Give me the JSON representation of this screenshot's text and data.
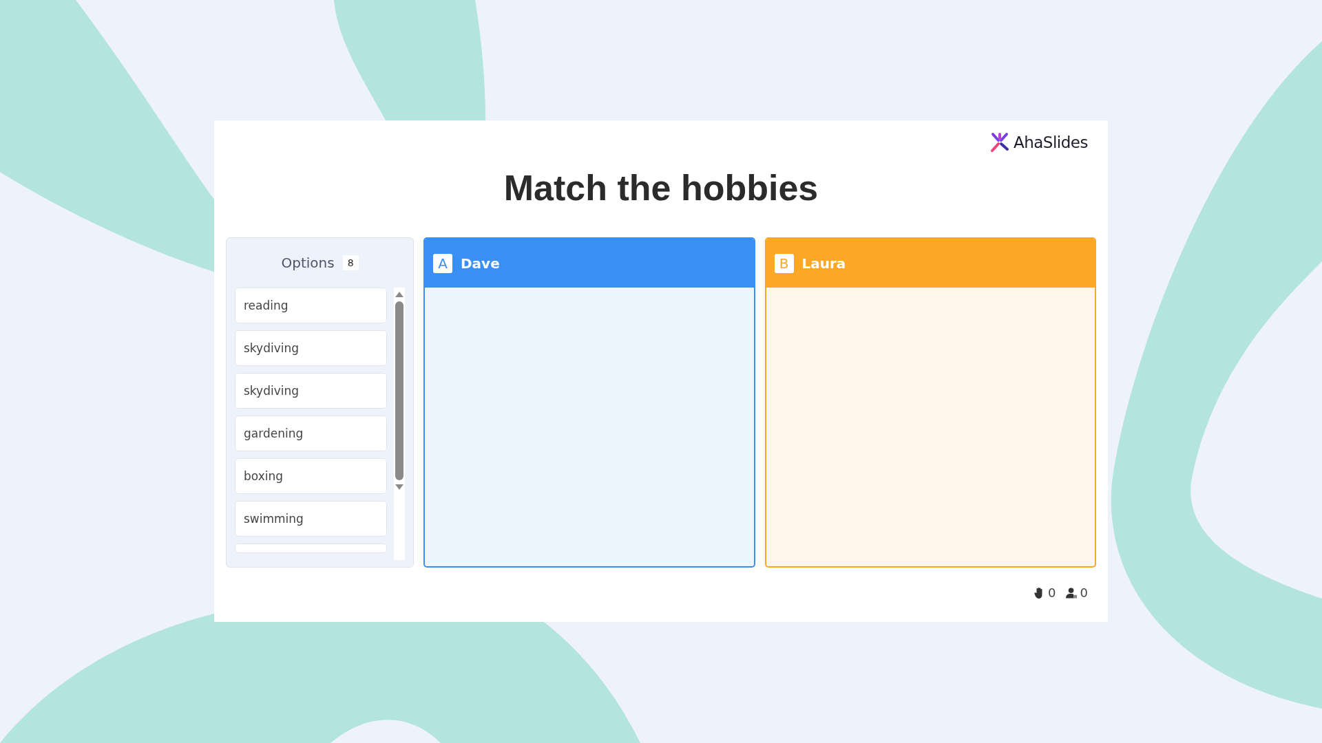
{
  "brand": {
    "name": "AhaSlides"
  },
  "title": "Match the hobbies",
  "options": {
    "label": "Options",
    "count": "8",
    "items": [
      {
        "kind": "option",
        "text": "reading"
      },
      {
        "kind": "option",
        "text": "skydiving"
      },
      {
        "kind": "option",
        "text": "skydiving"
      },
      {
        "kind": "option",
        "text": "gardening"
      },
      {
        "kind": "option",
        "text": "boxing"
      },
      {
        "kind": "option",
        "text": "swimming"
      },
      {
        "kind": "cut"
      }
    ]
  },
  "categories": [
    {
      "letter": "A",
      "name": "Dave",
      "color": "#3a8ff5"
    },
    {
      "letter": "B",
      "name": "Laura",
      "color": "#fca726"
    }
  ],
  "footer": {
    "reactions": "0",
    "participants": "0"
  }
}
